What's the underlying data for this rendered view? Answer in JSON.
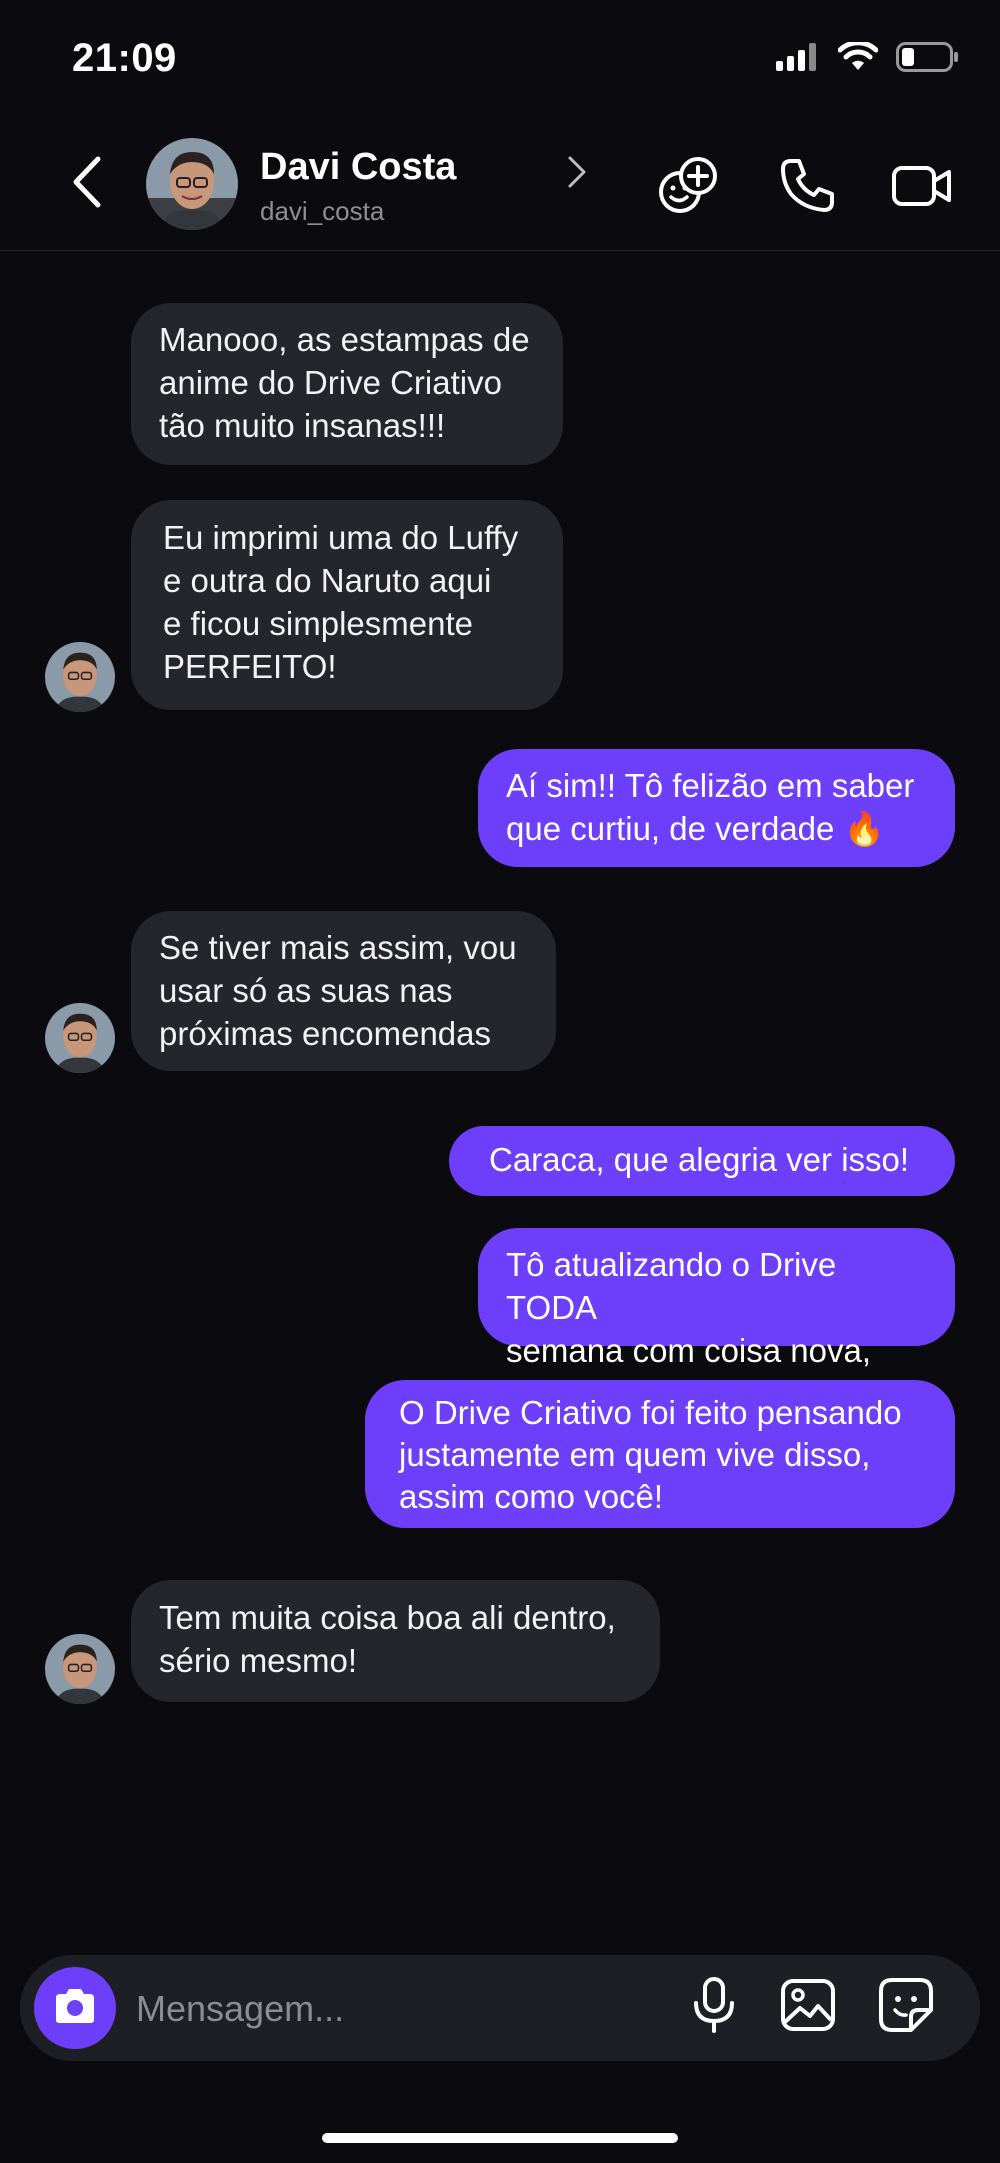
{
  "status_bar": {
    "time": "21:09",
    "icons": [
      "signal-icon",
      "wifi-icon",
      "battery-icon"
    ]
  },
  "header": {
    "contact_name": "Davi Costa",
    "contact_handle": "davi_costa",
    "icons": [
      "back-icon",
      "chevron-right-icon",
      "add-friend-icon",
      "phone-icon",
      "video-icon"
    ]
  },
  "messages": [
    {
      "direction": "incoming",
      "text": "Manooo, as estampas de\nanime do Drive Criativo\ntão muito insanas!!!"
    },
    {
      "direction": "incoming",
      "text": "Eu imprimi uma do Luffy\ne outra do Naruto aqui\ne ficou simplesmente\nPERFEITO!"
    },
    {
      "direction": "outgoing",
      "text": "Aí sim!! Tô felizão em saber\nque curtiu, de verdade 🔥"
    },
    {
      "direction": "incoming",
      "text": "Se tiver mais assim, vou\nusar só as suas nas\npróximas encomendas"
    },
    {
      "direction": "outgoing",
      "text": "Caraca, que alegria ver isso!"
    },
    {
      "direction": "outgoing",
      "text": "Tô atualizando o Drive TODA\nsemana com coisa nova, viu?"
    },
    {
      "direction": "outgoing",
      "text": "O Drive Criativo foi feito pensando\njustamente em quem vive disso,\nassim como você!"
    },
    {
      "direction": "incoming",
      "text": "Tem muita coisa boa ali dentro,\nsério mesmo!"
    }
  ],
  "composer": {
    "placeholder": "Mensagem...",
    "icons": [
      "camera-icon",
      "microphone-icon",
      "gallery-icon",
      "sticker-icon"
    ]
  },
  "colors": {
    "background": "#0b0b0f",
    "incoming_bubble": "#25262c",
    "outgoing_bubble": "#6e3ffb",
    "accent": "#6e3ffb"
  }
}
